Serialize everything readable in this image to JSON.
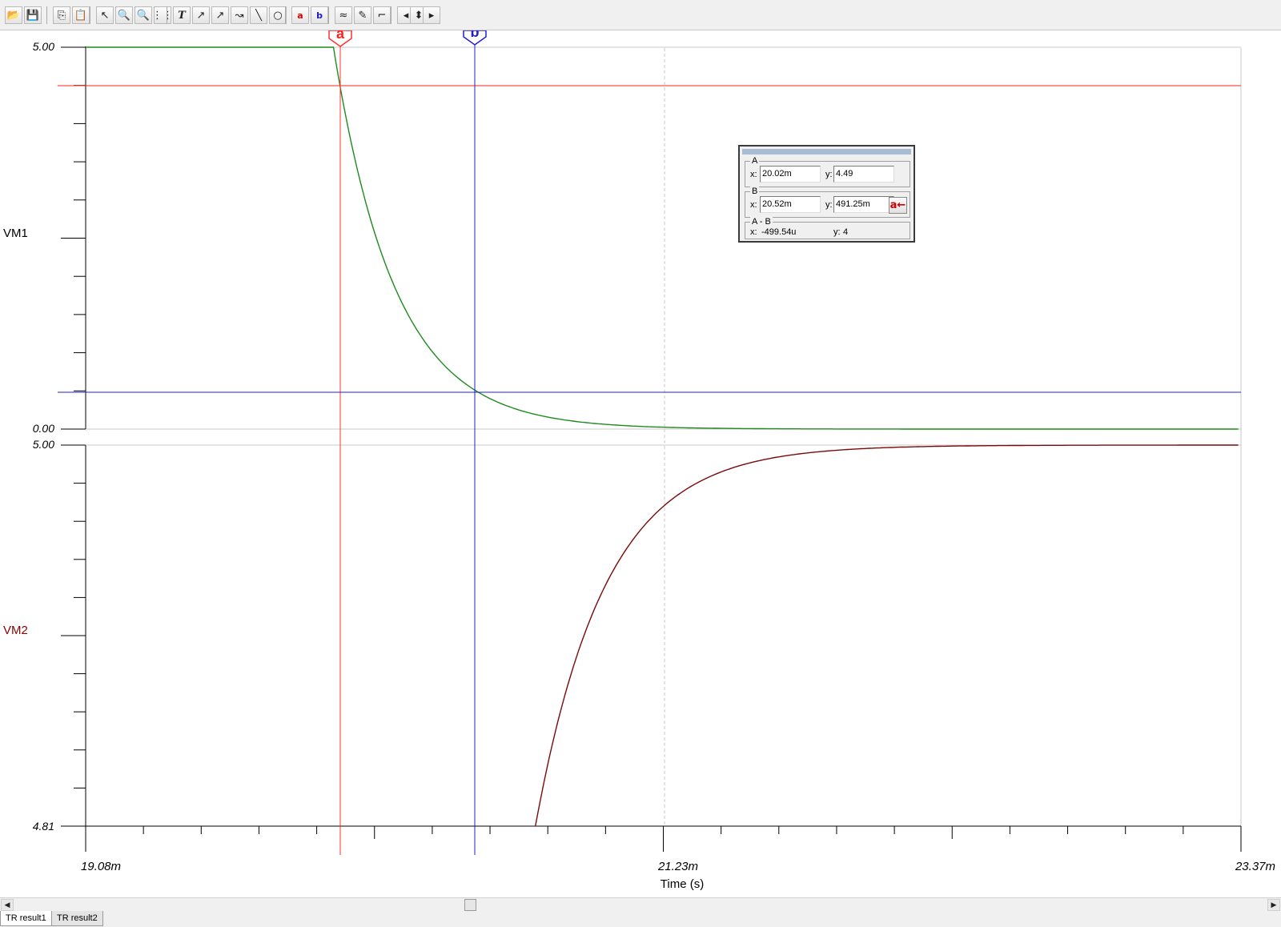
{
  "toolbar": {
    "buttons": [
      {
        "name": "open-icon",
        "glyph": "📂"
      },
      {
        "name": "save-icon",
        "glyph": "💾"
      },
      {
        "name": "copy-icon",
        "glyph": "⎘"
      },
      {
        "name": "paste-icon",
        "glyph": "📋"
      },
      {
        "name": "pointer-icon",
        "glyph": "↖"
      },
      {
        "name": "zoom-in-icon",
        "glyph": "🔍"
      },
      {
        "name": "zoom-100-icon",
        "glyph": "🔍"
      },
      {
        "name": "grid-icon",
        "glyph": "⋮⋮"
      },
      {
        "name": "text-icon",
        "glyph": "T"
      },
      {
        "name": "trace-label-icon",
        "glyph": "↗"
      },
      {
        "name": "trace-label2-icon",
        "glyph": "↗"
      },
      {
        "name": "trace-value-icon",
        "glyph": "↝"
      },
      {
        "name": "line-icon",
        "glyph": "╲"
      },
      {
        "name": "circle-icon",
        "glyph": "○"
      },
      {
        "name": "cursor-a-icon",
        "glyph": "a"
      },
      {
        "name": "cursor-b-icon",
        "glyph": "b"
      },
      {
        "name": "add-trace-icon",
        "glyph": "≈"
      },
      {
        "name": "pick-icon",
        "glyph": "✎"
      },
      {
        "name": "flag-icon",
        "glyph": "⌐"
      },
      {
        "name": "arrow-left-icon",
        "glyph": "◂"
      },
      {
        "name": "arrow-updown-icon",
        "glyph": "⬍"
      },
      {
        "name": "arrow-right-icon",
        "glyph": "▸"
      }
    ]
  },
  "plot": {
    "xlabel": "Time (s)",
    "x_ticks": [
      "19.08m",
      "21.23m",
      "23.37m"
    ],
    "top_panel": {
      "name": "VM1",
      "y_top": "5.00",
      "y_bottom": "0.00",
      "color": "#1f8a1f",
      "label_color": "#000000"
    },
    "bottom_panel": {
      "name": "VM2",
      "y_top": "5.00",
      "y_bottom": "4.81",
      "color": "#7a0a0a",
      "label_color": "#8b0000"
    },
    "cursor_a": {
      "label": "a",
      "color": "#ff3030"
    },
    "cursor_b": {
      "label": "b",
      "color": "#2020d0"
    },
    "grid_color": "#c8c8c8"
  },
  "chart_data": {
    "type": "line",
    "xlabel": "Time (s)",
    "xlim": [
      "19.08m",
      "23.37m"
    ],
    "series": [
      {
        "name": "VM1",
        "ylim": [
          0,
          5
        ],
        "x_ms": [
          19.08,
          20.0,
          20.02,
          20.2,
          20.4,
          20.52,
          20.8,
          21.23,
          21.6,
          22.0,
          23.37
        ],
        "y": [
          5.0,
          5.0,
          4.49,
          2.9,
          1.4,
          0.491,
          0.2,
          0.05,
          0.02,
          0.01,
          0.0
        ]
      },
      {
        "name": "VM2",
        "ylim": [
          4.81,
          5.0
        ],
        "x_ms": [
          20.75,
          20.85,
          21.0,
          21.23,
          21.5,
          21.8,
          22.3,
          23.37
        ],
        "y": [
          4.81,
          4.85,
          4.93,
          4.985,
          4.995,
          4.998,
          4.9995,
          5.0
        ]
      }
    ],
    "cursors": [
      {
        "label": "a",
        "x": "20.02m",
        "y": "4.49"
      },
      {
        "label": "b",
        "x": "20.52m",
        "y": "491.25m"
      }
    ]
  },
  "readout": {
    "a": {
      "title": "A",
      "x_label": "x:",
      "x": "20.02m",
      "y_label": "y:",
      "y": "4.49"
    },
    "b": {
      "title": "B",
      "x_label": "x:",
      "x": "20.52m",
      "y_label": "y:",
      "y": "491.25m",
      "swap_label": "a←"
    },
    "diff": {
      "title": "A - B",
      "x_label": "x:",
      "x": "-499.54u",
      "y_label": "y:",
      "y": "4"
    }
  },
  "tabs": [
    {
      "label": "TR result1",
      "active": true
    },
    {
      "label": "TR result2",
      "active": false
    }
  ]
}
